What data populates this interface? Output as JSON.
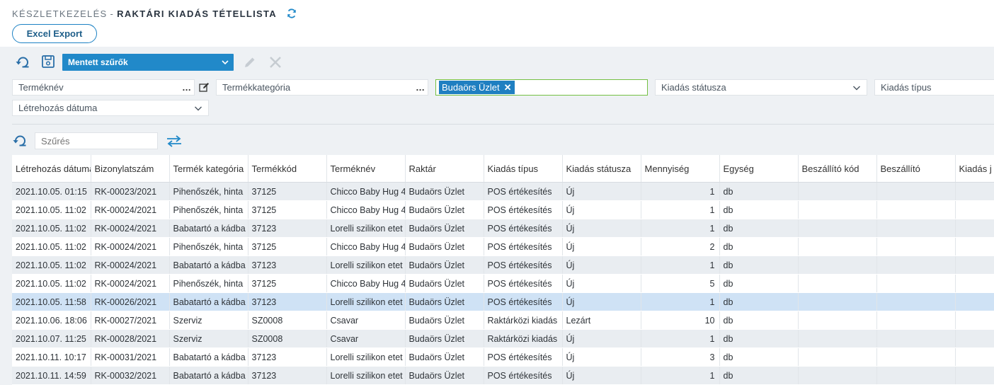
{
  "header": {
    "breadcrumb": "KÉSZLETKEZELÉS",
    "separator": "-",
    "title": "RAKTÁRI KIADÁS TÉTELLISTA",
    "export_label": "Excel Export"
  },
  "toolbar": {
    "saved_filters_label": "Mentett szűrők"
  },
  "filters": {
    "product_name": "Terméknév",
    "product_category": "Termékkategória",
    "warehouse_tag": "Budaörs Üzlet",
    "issue_status": "Kiadás státusza",
    "issue_type": "Kiadás típus",
    "created_date": "Létrehozás dátuma",
    "search_placeholder": "Szűrés"
  },
  "colors": {
    "accent": "#2189c9",
    "selected_row": "#cfe2f5",
    "alt_row": "#e9edf1",
    "active_border": "#74c043"
  },
  "table": {
    "columns": [
      "Létrehozás dátuma",
      "Bizonylatszám",
      "Termék kategória",
      "Termékkód",
      "Terméknév",
      "Raktár",
      "Kiadás típus",
      "Kiadás státusza",
      "Mennyiség",
      "Egység",
      "Beszállító kód",
      "Beszállító",
      "Kiadás j"
    ],
    "selected_row": 6,
    "rows": [
      [
        "2021.10.05. 01:15",
        "RK-00023/2021",
        "Pihenőszék, hinta",
        "37125",
        "Chicco Baby Hug 4",
        "Budaörs Üzlet",
        "POS értékesítés",
        "Új",
        "1",
        "db",
        "",
        "",
        ""
      ],
      [
        "2021.10.05. 11:02",
        "RK-00024/2021",
        "Pihenőszék, hinta",
        "37125",
        "Chicco Baby Hug 4",
        "Budaörs Üzlet",
        "POS értékesítés",
        "Új",
        "1",
        "db",
        "",
        "",
        ""
      ],
      [
        "2021.10.05. 11:02",
        "RK-00024/2021",
        "Babatartó a kádba",
        "37123",
        "Lorelli szilikon etet",
        "Budaörs Üzlet",
        "POS értékesítés",
        "Új",
        "1",
        "db",
        "",
        "",
        ""
      ],
      [
        "2021.10.05. 11:02",
        "RK-00024/2021",
        "Pihenőszék, hinta",
        "37125",
        "Chicco Baby Hug 4",
        "Budaörs Üzlet",
        "POS értékesítés",
        "Új",
        "2",
        "db",
        "",
        "",
        ""
      ],
      [
        "2021.10.05. 11:02",
        "RK-00024/2021",
        "Babatartó a kádba",
        "37123",
        "Lorelli szilikon etet",
        "Budaörs Üzlet",
        "POS értékesítés",
        "Új",
        "1",
        "db",
        "",
        "",
        ""
      ],
      [
        "2021.10.05. 11:02",
        "RK-00024/2021",
        "Pihenőszék, hinta",
        "37125",
        "Chicco Baby Hug 4",
        "Budaörs Üzlet",
        "POS értékesítés",
        "Új",
        "5",
        "db",
        "",
        "",
        ""
      ],
      [
        "2021.10.05. 11:58",
        "RK-00026/2021",
        "Babatartó a kádba",
        "37123",
        "Lorelli szilikon etet",
        "Budaörs Üzlet",
        "POS értékesítés",
        "Új",
        "1",
        "db",
        "",
        "",
        ""
      ],
      [
        "2021.10.06. 18:06",
        "RK-00027/2021",
        "Szerviz",
        "SZ0008",
        "Csavar",
        "Budaörs Üzlet",
        "Raktárközi kiadás",
        "Lezárt",
        "10",
        "db",
        "",
        "",
        ""
      ],
      [
        "2021.10.07. 11:25",
        "RK-00028/2021",
        "Szerviz",
        "SZ0008",
        "Csavar",
        "Budaörs Üzlet",
        "Raktárközi kiadás",
        "Új",
        "1",
        "db",
        "",
        "",
        ""
      ],
      [
        "2021.10.11. 10:17",
        "RK-00031/2021",
        "Babatartó a kádba",
        "37123",
        "Lorelli szilikon etet",
        "Budaörs Üzlet",
        "POS értékesítés",
        "Új",
        "3",
        "db",
        "",
        "",
        ""
      ],
      [
        "2021.10.11. 14:59",
        "RK-00032/2021",
        "Babatartó a kádba",
        "37123",
        "Lorelli szilikon etet",
        "Budaörs Üzlet",
        "POS értékesítés",
        "Új",
        "1",
        "db",
        "",
        "",
        ""
      ]
    ]
  }
}
